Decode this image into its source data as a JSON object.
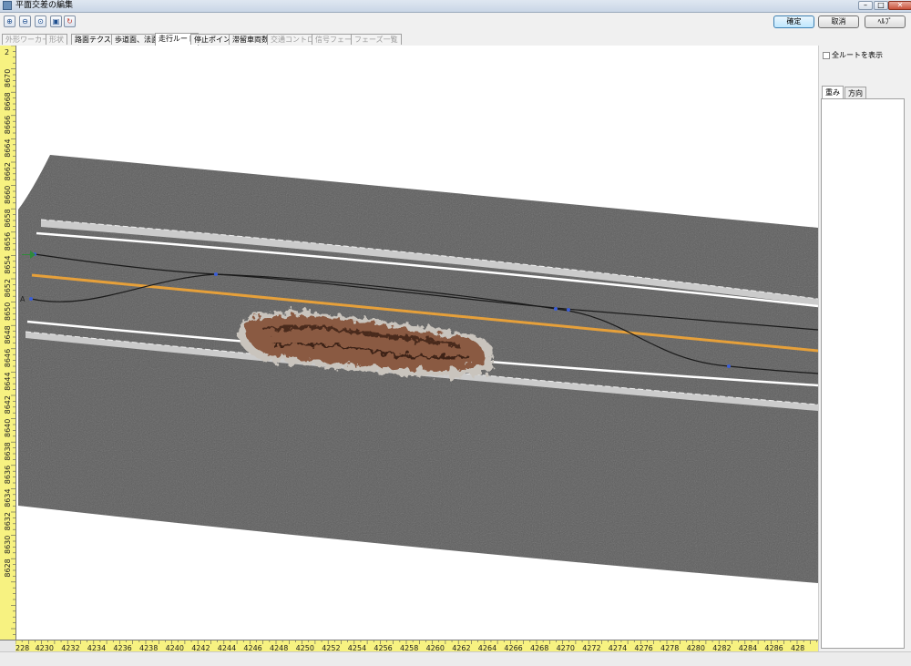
{
  "window": {
    "title": "平面交差の編集"
  },
  "toolbar": {
    "icons": [
      "zoom-in-icon",
      "zoom-out-icon",
      "zoom-fit-icon",
      "save-icon",
      "refresh-icon"
    ],
    "ok_label": "確定",
    "cancel_label": "取消",
    "help_label": "ﾍﾙﾌﾟ"
  },
  "tabs": [
    {
      "label": "外形ワーカー",
      "state": "disabled"
    },
    {
      "label": "形状",
      "state": "disabled"
    },
    {
      "label": "路面テクスチャ",
      "state": "enabled"
    },
    {
      "label": "歩道面、法面",
      "state": "enabled"
    },
    {
      "label": "走行ルート",
      "state": "active"
    },
    {
      "label": "停止ポイント",
      "state": "enabled"
    },
    {
      "label": "滞留車両数",
      "state": "enabled"
    },
    {
      "label": "交通コントロール",
      "state": "disabled"
    },
    {
      "label": "信号フェーズ",
      "state": "disabled"
    },
    {
      "label": "フェーズ一覧",
      "state": "disabled"
    }
  ],
  "canvas": {
    "route_start_label": "A",
    "v_ruler_top_label": "2",
    "v_ruler_labels": [
      "8670",
      "8668",
      "8666",
      "8664",
      "8662",
      "8660",
      "8658",
      "8656",
      "8654",
      "8652",
      "8650",
      "8648",
      "8646",
      "8644",
      "8642",
      "8640",
      "8638",
      "8636",
      "8634",
      "8632",
      "8630",
      "8628"
    ],
    "h_ruler_labels": [
      "228",
      "4230",
      "4232",
      "4234",
      "4236",
      "4238",
      "4240",
      "4242",
      "4244",
      "4246",
      "4248",
      "4250",
      "4252",
      "4254",
      "4256",
      "4258",
      "4260",
      "4262",
      "4264",
      "4266",
      "4268",
      "4270",
      "4272",
      "4274",
      "4276",
      "4278",
      "4280",
      "4282",
      "4284",
      "4286",
      "428"
    ],
    "colors": {
      "road": "#5f5f5f",
      "center_line": "#e6a03a",
      "lane_line": "#ffffff",
      "curb": "#c9c9c9",
      "route": "#1a1a1a",
      "ruler": "#f7f281"
    }
  },
  "right_panel": {
    "show_all_routes_label": "全ルートを表示",
    "show_all_routes_checked": false,
    "tabs": [
      {
        "label": "重み",
        "active": true
      },
      {
        "label": "方向",
        "active": false
      }
    ]
  }
}
